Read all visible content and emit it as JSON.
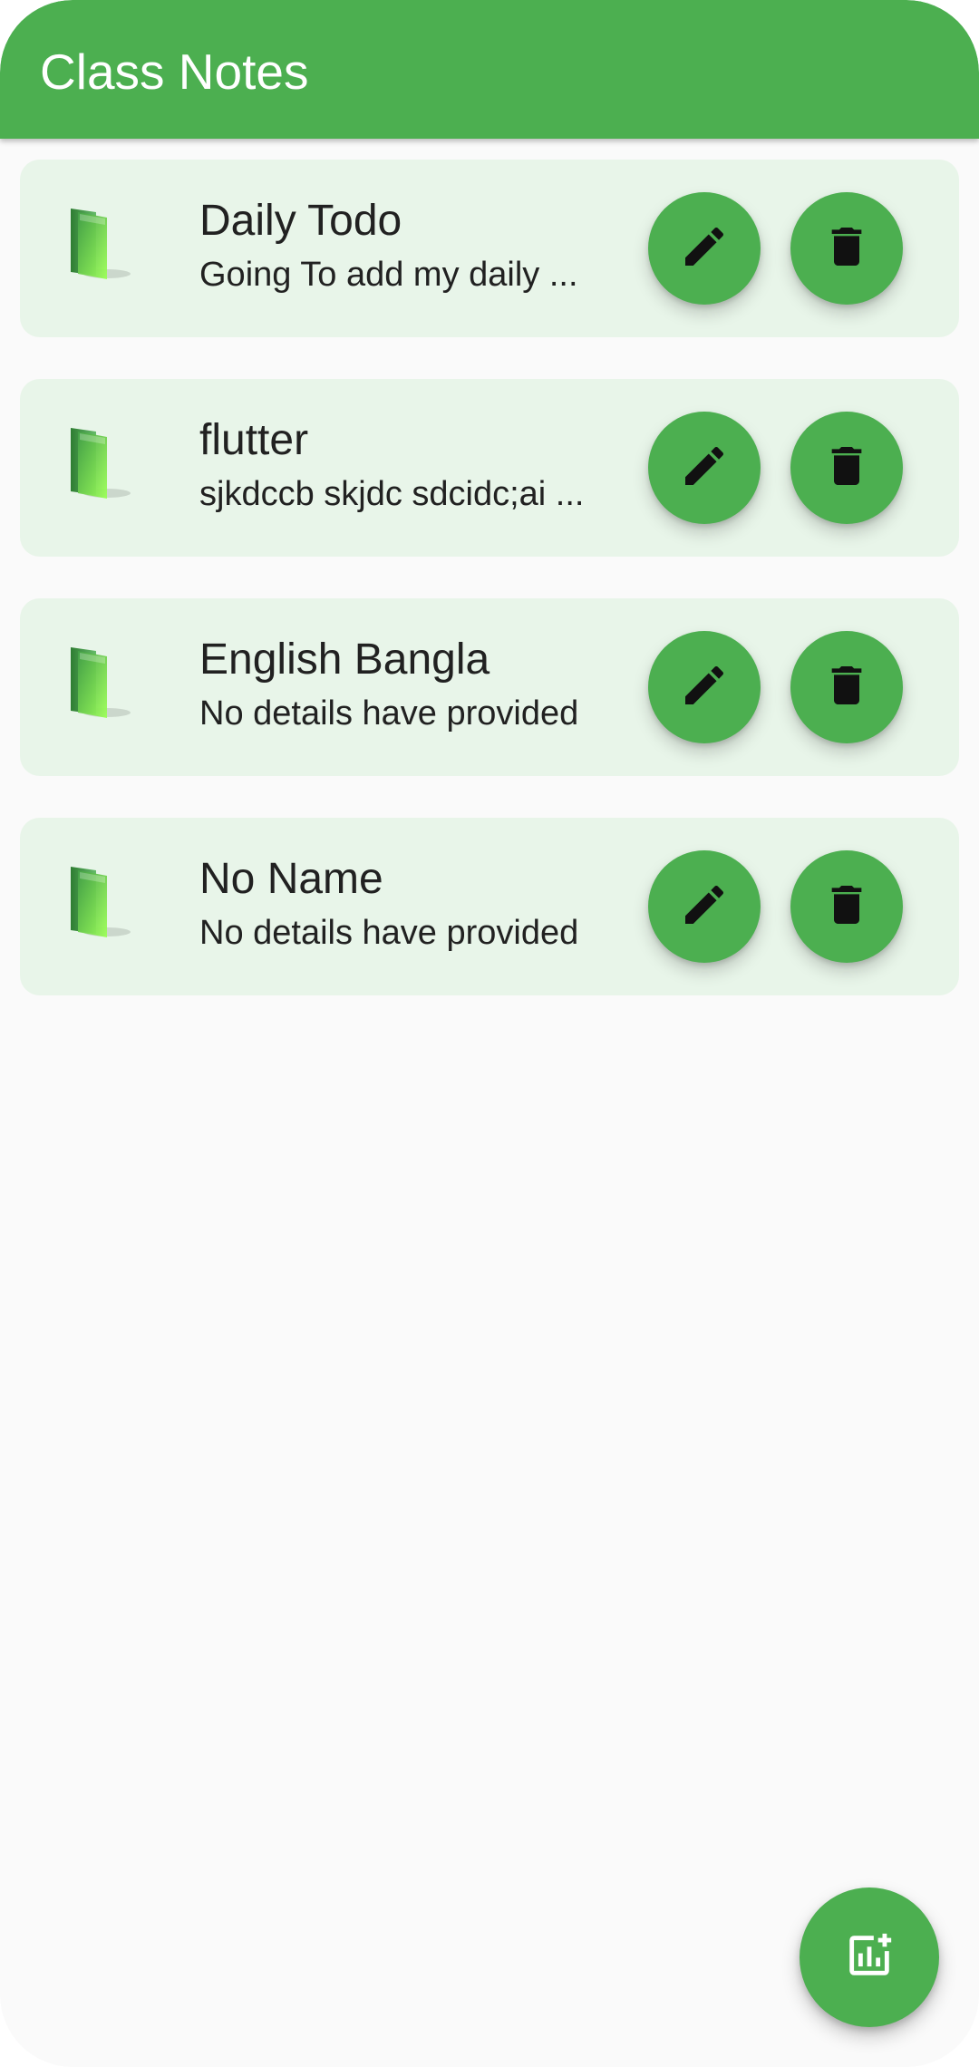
{
  "app_bar": {
    "title": "Class Notes"
  },
  "notes": [
    {
      "title": "Daily Todo",
      "description": "Going To add my daily ...",
      "icon": "folder-icon",
      "edit_icon": "pencil-icon",
      "delete_icon": "trash-icon"
    },
    {
      "title": "flutter",
      "description": "sjkdccb skjdc sdcidc;ai ...",
      "icon": "folder-icon",
      "edit_icon": "pencil-icon",
      "delete_icon": "trash-icon"
    },
    {
      "title": "English Bangla",
      "description": "No details have provided",
      "icon": "folder-icon",
      "edit_icon": "pencil-icon",
      "delete_icon": "trash-icon"
    },
    {
      "title": "No Name",
      "description": "No details have provided",
      "icon": "folder-icon",
      "edit_icon": "pencil-icon",
      "delete_icon": "trash-icon"
    }
  ],
  "fab": {
    "icon": "add-chart-icon"
  },
  "colors": {
    "primary": "#4caf50",
    "card_background": "#e8f5e9",
    "screen_background": "#fafafa",
    "text": "#212121",
    "icon": "#111111"
  }
}
